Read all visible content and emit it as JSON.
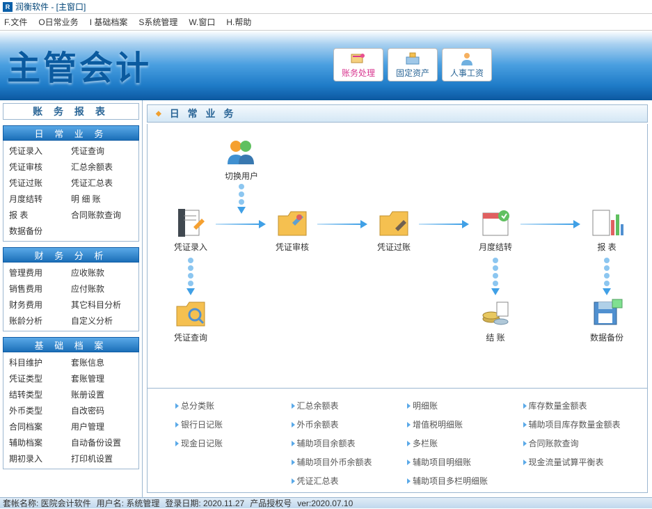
{
  "window": {
    "title": "润衡软件 - [主窗口]"
  },
  "menu": [
    "F.文件",
    "O日常业务",
    "I 基础档案",
    "S系统管理",
    "W.窗口",
    "H.帮助"
  ],
  "banner": {
    "title": "主管会计",
    "buttons": [
      "账务处理",
      "固定资产",
      "人事工资"
    ]
  },
  "sidebar": {
    "title": "账 务 报 表",
    "sections": [
      {
        "title": "日 常 业 务",
        "items": [
          "凭证录入",
          "凭证查询",
          "凭证审核",
          "汇总余额表",
          "凭证过账",
          "凭证汇总表",
          "月度结转",
          "明 细 账",
          "报    表",
          "合同账款查询",
          "数据备份",
          ""
        ]
      },
      {
        "title": "财 务 分 析",
        "items": [
          "管理费用",
          "应收账款",
          "销售费用",
          "应付账款",
          "财务费用",
          "其它科目分析",
          "账龄分析",
          "自定义分析"
        ]
      },
      {
        "title": "基 础 档 案",
        "items": [
          "科目维护",
          "套账信息",
          "凭证类型",
          "套账管理",
          "结转类型",
          "账册设置",
          "外币类型",
          "自改密码",
          "合同档案",
          "用户管理",
          "辅助档案",
          "自动备份设置",
          "期初录入",
          "打印机设置"
        ]
      }
    ]
  },
  "content": {
    "header": "日 常 业 务",
    "nodes": {
      "switch_user": "切换用户",
      "entry": "凭证录入",
      "review": "凭证审核",
      "post": "凭证过账",
      "close": "月度结转",
      "report": "报 表",
      "query": "凭证查询",
      "settle": "结 账",
      "backup": "数据备份"
    },
    "links": [
      "总分类账",
      "汇总余额表",
      "明细账",
      "库存数量金额表",
      "银行日记账",
      "外币余额表",
      "增值税明细账",
      "辅助项目库存数量金额表",
      "现金日记账",
      "辅助项目余额表",
      "多栏账",
      "合同账款查询",
      "",
      "辅助项目外币余额表",
      "辅助项目明细账",
      "现金流量试算平衡表",
      "",
      "凭证汇总表",
      "辅助项目多栏明细账",
      ""
    ]
  },
  "status": {
    "acct": "套帐名称: 医院会计软件",
    "user": "用户名: 系统管理",
    "date": "登录日期: 2020.11.27",
    "auth": "产品授权号",
    "ver": "ver:2020.07.10"
  }
}
